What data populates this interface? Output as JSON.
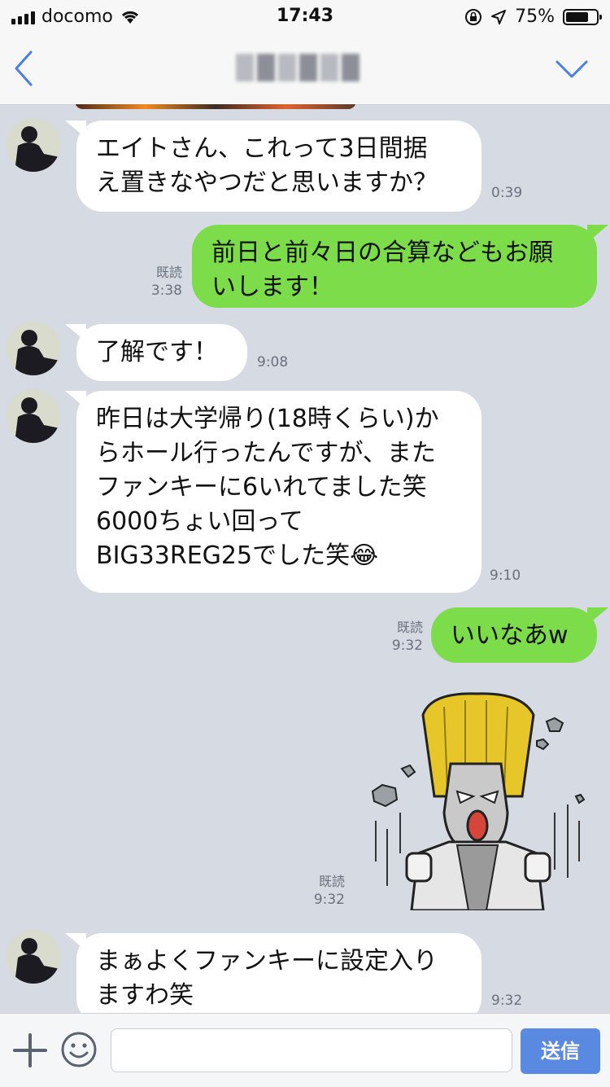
{
  "status": {
    "carrier": "docomo",
    "time": "17:43",
    "battery": "75%",
    "battery_level": 0.75
  },
  "header": {
    "back_icon": "chevron-left-icon",
    "menu_icon": "chevron-down-icon"
  },
  "messages": [
    {
      "side": "in",
      "text_lines": [
        "エイトさん、これって3日間据",
        "え置きなやつだと思いますか？"
      ],
      "time": "0:39"
    },
    {
      "side": "out",
      "text_lines": [
        "前日と前々日の合算などもお願",
        "いします！"
      ],
      "read": "既読",
      "time": "3:38"
    },
    {
      "side": "in",
      "text_lines": [
        "了解です！"
      ],
      "time": "9:08"
    },
    {
      "side": "in",
      "text_lines": [
        "昨日は大学帰り(18時くらい)か",
        "らホール行ったんですが、また",
        "ファンキーに6いれてました笑",
        "6000ちょい回って",
        "BIG33REG25でした笑😂"
      ],
      "time": "9:10"
    },
    {
      "side": "out",
      "text_lines": [
        "いいなあw"
      ],
      "read": "既読",
      "time": "9:32"
    },
    {
      "side": "out",
      "type": "sticker",
      "sticker_icon": "shouting-man-sticker-icon",
      "read": "既読",
      "time": "9:32"
    },
    {
      "side": "in",
      "text_lines": [
        "まぁよくファンキーに設定入り",
        "ますわ笑"
      ],
      "time": "9:32"
    }
  ],
  "input": {
    "plus_icon": "plus-icon",
    "emoji_icon": "smiley-icon",
    "placeholder": "",
    "send_label": "送信"
  },
  "colors": {
    "chat_bg": "#d5dae3",
    "outgoing_bubble": "#7ddc4a",
    "incoming_bubble": "#ffffff",
    "send_button": "#4a7ee0"
  }
}
